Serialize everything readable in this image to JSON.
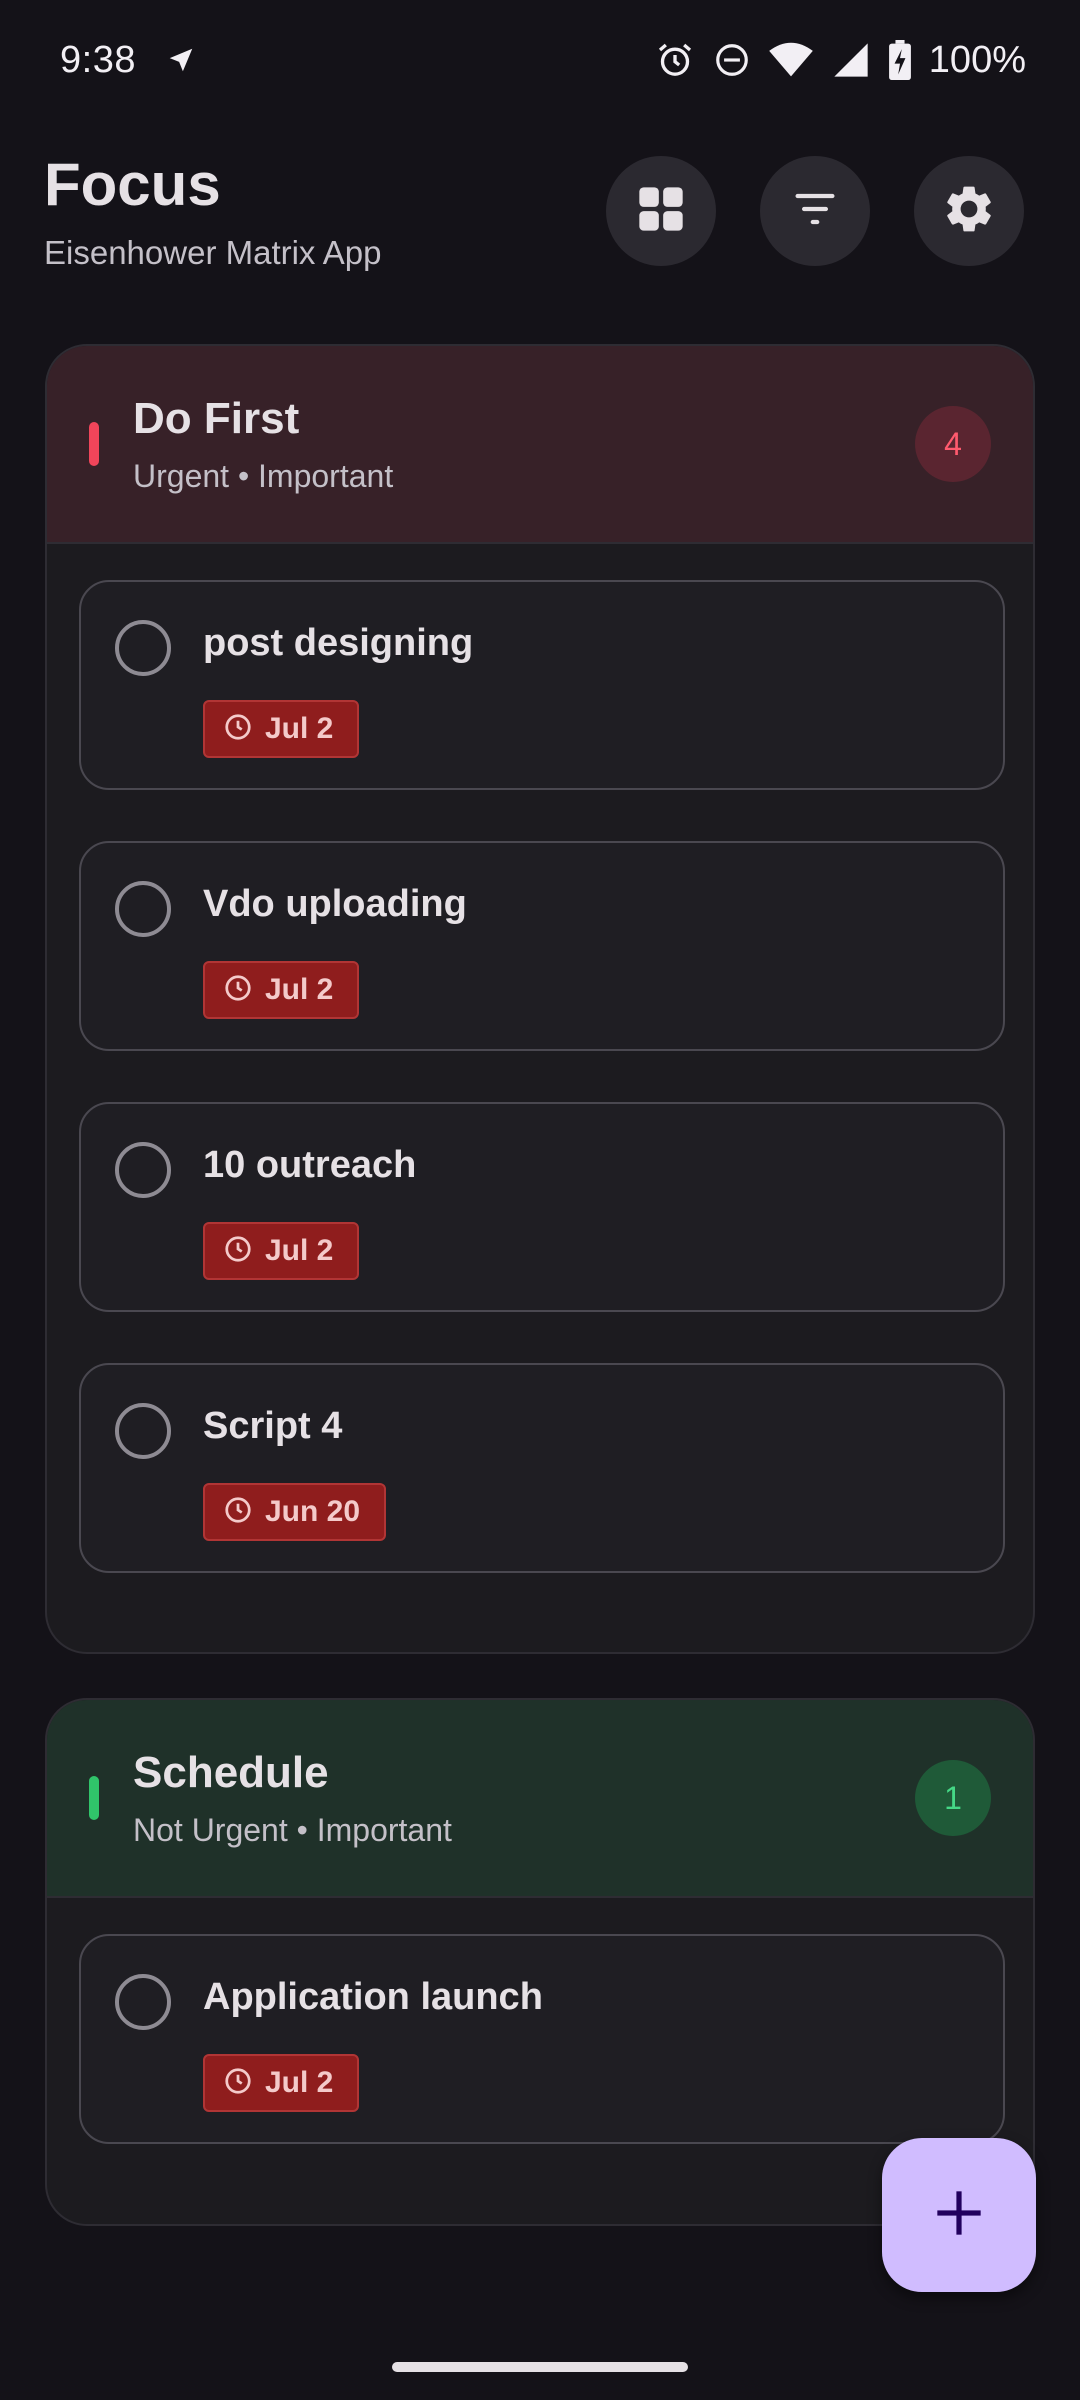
{
  "status_bar": {
    "time": "9:38",
    "battery": "100%",
    "icons": [
      "navigation-icon",
      "alarm-icon",
      "do-not-disturb-icon",
      "wifi-icon",
      "signal-icon",
      "battery-charging-icon"
    ]
  },
  "header": {
    "title": "Focus",
    "subtitle": "Eisenhower Matrix App",
    "buttons": [
      "grid-view-icon",
      "filter-icon",
      "settings-icon"
    ]
  },
  "sections": [
    {
      "title": "Do First",
      "subtitle": "Urgent • Important",
      "count": "4",
      "accent": "#F0455A",
      "tasks": [
        {
          "title": "post designing",
          "due": "Jul 2"
        },
        {
          "title": "Vdo uploading",
          "due": "Jul 2"
        },
        {
          "title": "10 outreach",
          "due": "Jul 2"
        },
        {
          "title": "Script 4",
          "due": "Jun 20"
        }
      ]
    },
    {
      "title": "Schedule",
      "subtitle": "Not Urgent • Important",
      "count": "1",
      "accent": "#30C46A",
      "tasks": [
        {
          "title": "Application launch",
          "due": "Jul 2"
        }
      ]
    }
  ],
  "fab": {
    "icon": "plus-icon",
    "color": "#D0BCFF"
  },
  "colors": {
    "background": "#141218",
    "due_chip": "#8F1D1D"
  }
}
